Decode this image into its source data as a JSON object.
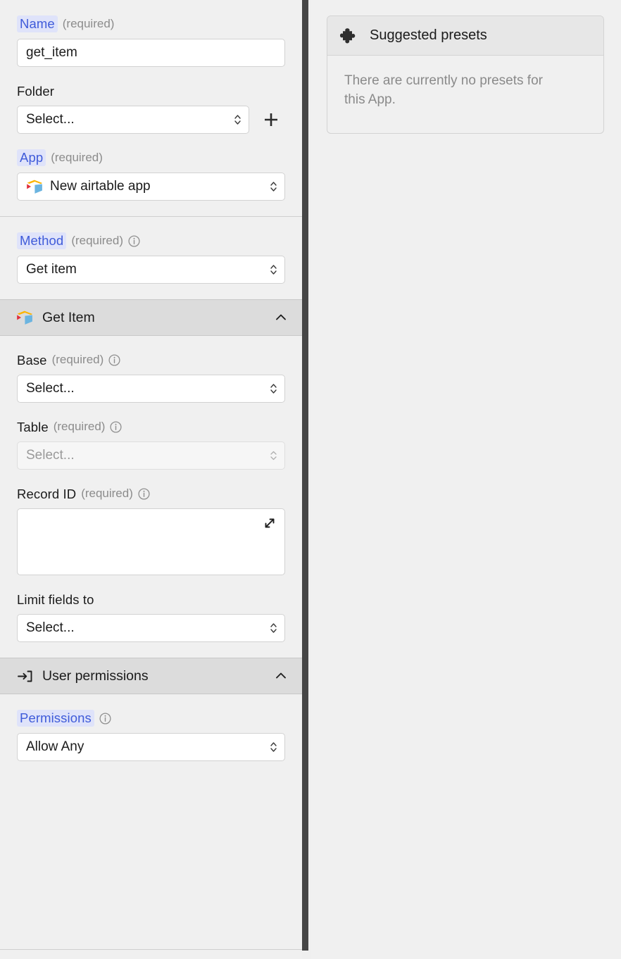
{
  "config_panel": {
    "general": {
      "name_field": {
        "label": "Name",
        "required_text": "(required)",
        "value": "get_item",
        "placeholder": ""
      },
      "folder_field": {
        "label": "Folder",
        "value": "Select...",
        "add_button_icon": "plus-icon"
      },
      "app_field": {
        "label": "App",
        "required_text": "(required)",
        "value": "New airtable app",
        "icon": "airtable-logo-icon"
      }
    },
    "method_section": {
      "method_field": {
        "label": "Method",
        "required_text": "(required)",
        "info_icon": "info-circle-icon",
        "value": "Get item"
      }
    },
    "get_item_section": {
      "header": {
        "title": "Get Item",
        "icon": "airtable-logo-icon",
        "collapse_icon": "chevron-up-icon"
      },
      "base_field": {
        "label": "Base",
        "required_text": "(required)",
        "info_icon": "info-circle-icon",
        "value": "Select..."
      },
      "table_field": {
        "label": "Table",
        "required_text": "(required)",
        "info_icon": "info-circle-icon",
        "value": "Select...",
        "disabled": true
      },
      "record_id_field": {
        "label": "Record ID",
        "required_text": "(required)",
        "info_icon": "info-circle-icon",
        "value": "",
        "expand_icon": "expand-diagonal-icon"
      },
      "limit_fields_field": {
        "label": "Limit fields to",
        "value": "Select..."
      }
    },
    "user_permissions_section": {
      "header": {
        "title": "User permissions",
        "icon": "login-arrow-icon",
        "collapse_icon": "chevron-up-icon"
      },
      "permissions_field": {
        "label": "Permissions",
        "info_icon": "info-circle-icon",
        "value": "Allow Any"
      }
    }
  },
  "presets_panel": {
    "card": {
      "title": "Suggested presets",
      "icon": "puzzle-piece-icon",
      "empty_message": "There are currently no presets for this App."
    }
  },
  "colors": {
    "accent_blue": "#3f5bd9",
    "chip_background": "#dfe3fa",
    "panel_background": "#f0f0f0",
    "section_header_background": "#dcdcdc",
    "muted_text": "#8c8c8c",
    "scrollbar_thumb": "#464646"
  }
}
